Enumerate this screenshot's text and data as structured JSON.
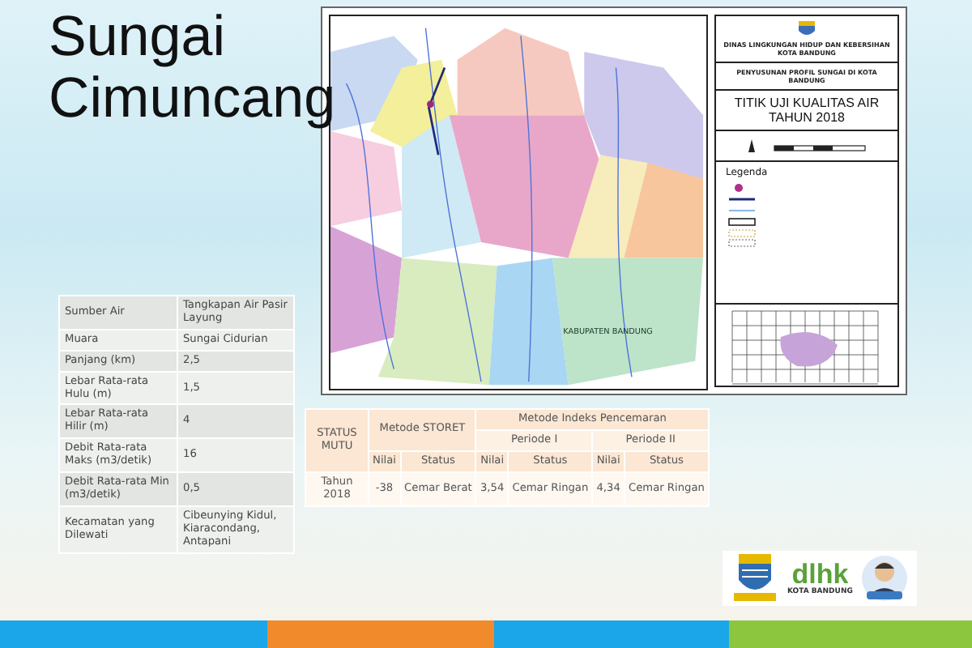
{
  "title": "Sungai Cimuncang",
  "info_table": [
    {
      "label": "Sumber Air",
      "value": "Tangkapan Air Pasir Layung"
    },
    {
      "label": "Muara",
      "value": "Sungai Cidurian"
    },
    {
      "label": "Panjang (km)",
      "value": "2,5"
    },
    {
      "label": "Lebar Rata-rata Hulu (m)",
      "value": "1,5"
    },
    {
      "label": "Lebar Rata-rata Hilir (m)",
      "value": "4"
    },
    {
      "label": "Debit Rata-rata Maks (m3/detik)",
      "value": "16"
    },
    {
      "label": "Debit Rata-rata Min (m3/detik)",
      "value": "0,5"
    },
    {
      "label": "Kecamatan yang Dilewati",
      "value": "Cibeunying Kidul, Kiaracondang, Antapani"
    }
  ],
  "quality_table": {
    "status_heading": "STATUS MUTU",
    "storet_heading": "Metode STORET",
    "ip_heading": "Metode Indeks Pencemaran",
    "periods": [
      "Periode I",
      "Periode II"
    ],
    "subheadings": [
      "Nilai",
      "Status",
      "Nilai",
      "Status",
      "Nilai",
      "Status"
    ],
    "row": {
      "label": "Tahun 2018",
      "cells": [
        "-38",
        "Cemar Berat",
        "3,54",
        "Cemar Ringan",
        "4,34",
        "Cemar Ringan"
      ]
    }
  },
  "map": {
    "region_label": "KABUPATEN BANDUNG",
    "agency": "DINAS LINGKUNGAN HIDUP DAN KEBERSIHAN KOTA BANDUNG",
    "project": "PENYUSUNAN PROFIL SUNGAI DI KOTA BANDUNG",
    "heading": "TITIK UJI KUALITAS AIR TAHUN 2018",
    "legend_title": "Legenda"
  },
  "logos": {
    "brand": "dlhk",
    "city": "KOTA BANDUNG"
  }
}
